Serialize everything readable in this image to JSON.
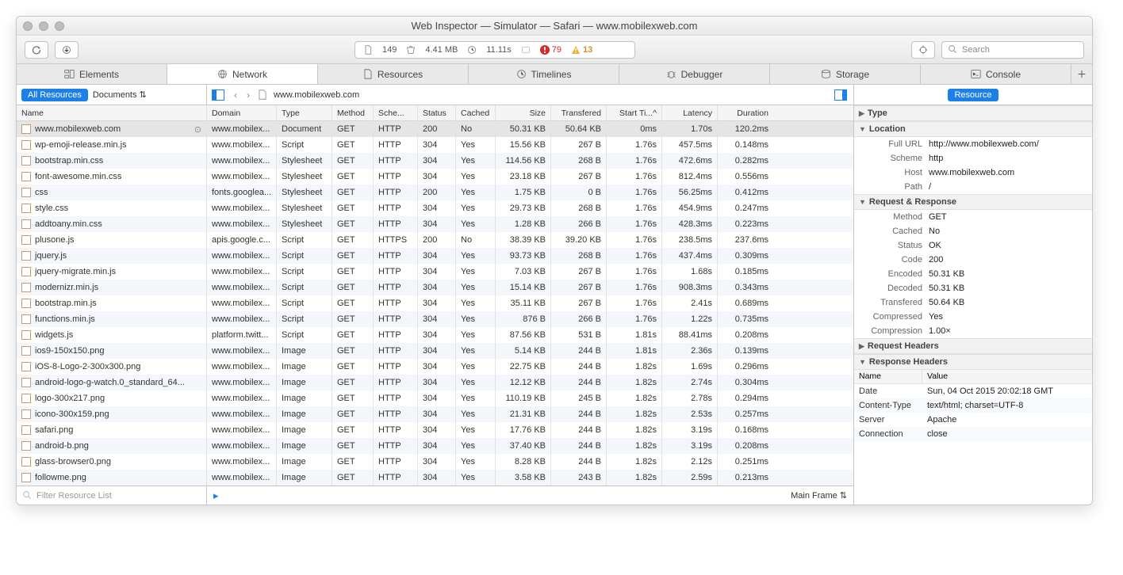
{
  "window_title": "Web Inspector — Simulator — Safari — www.mobilexweb.com",
  "toolbar": {
    "counts_file": "149",
    "weight": "4.41 MB",
    "time": "11.11s",
    "errors": "79",
    "warnings": "13",
    "search_placeholder": "Search"
  },
  "tabs": [
    "Elements",
    "Network",
    "Resources",
    "Timelines",
    "Debugger",
    "Storage",
    "Console"
  ],
  "filterbar": {
    "pill": "All Resources",
    "doc": "Documents",
    "crumb": "www.mobilexweb.com"
  },
  "side_pill": "Resource",
  "columns": [
    "Name",
    "Domain",
    "Type",
    "Method",
    "Sche...",
    "Status",
    "Cached",
    "Size",
    "Transfered",
    "Start Ti...",
    "Latency",
    "Duration"
  ],
  "rows": [
    {
      "name": "www.mobilexweb.com",
      "dom": "www.mobilex...",
      "type": "Document",
      "meth": "GET",
      "sch": "HTTP",
      "stat": "200",
      "cac": "No",
      "size": "50.31 KB",
      "tran": "50.64 KB",
      "start": "0ms",
      "lat": "1.70s",
      "dur": "120.2ms",
      "sel": true
    },
    {
      "name": "wp-emoji-release.min.js",
      "dom": "www.mobilex...",
      "type": "Script",
      "meth": "GET",
      "sch": "HTTP",
      "stat": "304",
      "cac": "Yes",
      "size": "15.56 KB",
      "tran": "267 B",
      "start": "1.76s",
      "lat": "457.5ms",
      "dur": "0.148ms"
    },
    {
      "name": "bootstrap.min.css",
      "dom": "www.mobilex...",
      "type": "Stylesheet",
      "meth": "GET",
      "sch": "HTTP",
      "stat": "304",
      "cac": "Yes",
      "size": "114.56 KB",
      "tran": "268 B",
      "start": "1.76s",
      "lat": "472.6ms",
      "dur": "0.282ms"
    },
    {
      "name": "font-awesome.min.css",
      "dom": "www.mobilex...",
      "type": "Stylesheet",
      "meth": "GET",
      "sch": "HTTP",
      "stat": "304",
      "cac": "Yes",
      "size": "23.18 KB",
      "tran": "267 B",
      "start": "1.76s",
      "lat": "812.4ms",
      "dur": "0.556ms"
    },
    {
      "name": "css",
      "dom": "fonts.googlea...",
      "type": "Stylesheet",
      "meth": "GET",
      "sch": "HTTP",
      "stat": "200",
      "cac": "Yes",
      "size": "1.75 KB",
      "tran": "0 B",
      "start": "1.76s",
      "lat": "56.25ms",
      "dur": "0.412ms"
    },
    {
      "name": "style.css",
      "dom": "www.mobilex...",
      "type": "Stylesheet",
      "meth": "GET",
      "sch": "HTTP",
      "stat": "304",
      "cac": "Yes",
      "size": "29.73 KB",
      "tran": "268 B",
      "start": "1.76s",
      "lat": "454.9ms",
      "dur": "0.247ms"
    },
    {
      "name": "addtoany.min.css",
      "dom": "www.mobilex...",
      "type": "Stylesheet",
      "meth": "GET",
      "sch": "HTTP",
      "stat": "304",
      "cac": "Yes",
      "size": "1.28 KB",
      "tran": "266 B",
      "start": "1.76s",
      "lat": "428.3ms",
      "dur": "0.223ms"
    },
    {
      "name": "plusone.js",
      "dom": "apis.google.c...",
      "type": "Script",
      "meth": "GET",
      "sch": "HTTPS",
      "stat": "200",
      "cac": "No",
      "size": "38.39 KB",
      "tran": "39.20 KB",
      "start": "1.76s",
      "lat": "238.5ms",
      "dur": "237.6ms"
    },
    {
      "name": "jquery.js",
      "dom": "www.mobilex...",
      "type": "Script",
      "meth": "GET",
      "sch": "HTTP",
      "stat": "304",
      "cac": "Yes",
      "size": "93.73 KB",
      "tran": "268 B",
      "start": "1.76s",
      "lat": "437.4ms",
      "dur": "0.309ms"
    },
    {
      "name": "jquery-migrate.min.js",
      "dom": "www.mobilex...",
      "type": "Script",
      "meth": "GET",
      "sch": "HTTP",
      "stat": "304",
      "cac": "Yes",
      "size": "7.03 KB",
      "tran": "267 B",
      "start": "1.76s",
      "lat": "1.68s",
      "dur": "0.185ms"
    },
    {
      "name": "modernizr.min.js",
      "dom": "www.mobilex...",
      "type": "Script",
      "meth": "GET",
      "sch": "HTTP",
      "stat": "304",
      "cac": "Yes",
      "size": "15.14 KB",
      "tran": "267 B",
      "start": "1.76s",
      "lat": "908.3ms",
      "dur": "0.343ms"
    },
    {
      "name": "bootstrap.min.js",
      "dom": "www.mobilex...",
      "type": "Script",
      "meth": "GET",
      "sch": "HTTP",
      "stat": "304",
      "cac": "Yes",
      "size": "35.11 KB",
      "tran": "267 B",
      "start": "1.76s",
      "lat": "2.41s",
      "dur": "0.689ms"
    },
    {
      "name": "functions.min.js",
      "dom": "www.mobilex...",
      "type": "Script",
      "meth": "GET",
      "sch": "HTTP",
      "stat": "304",
      "cac": "Yes",
      "size": "876 B",
      "tran": "266 B",
      "start": "1.76s",
      "lat": "1.22s",
      "dur": "0.735ms"
    },
    {
      "name": "widgets.js",
      "dom": "platform.twitt...",
      "type": "Script",
      "meth": "GET",
      "sch": "HTTP",
      "stat": "304",
      "cac": "Yes",
      "size": "87.56 KB",
      "tran": "531 B",
      "start": "1.81s",
      "lat": "88.41ms",
      "dur": "0.208ms"
    },
    {
      "name": "ios9-150x150.png",
      "dom": "www.mobilex...",
      "type": "Image",
      "meth": "GET",
      "sch": "HTTP",
      "stat": "304",
      "cac": "Yes",
      "size": "5.14 KB",
      "tran": "244 B",
      "start": "1.81s",
      "lat": "2.36s",
      "dur": "0.139ms"
    },
    {
      "name": "iOS-8-Logo-2-300x300.png",
      "dom": "www.mobilex...",
      "type": "Image",
      "meth": "GET",
      "sch": "HTTP",
      "stat": "304",
      "cac": "Yes",
      "size": "22.75 KB",
      "tran": "244 B",
      "start": "1.82s",
      "lat": "1.69s",
      "dur": "0.296ms"
    },
    {
      "name": "android-logo-g-watch.0_standard_64...",
      "dom": "www.mobilex...",
      "type": "Image",
      "meth": "GET",
      "sch": "HTTP",
      "stat": "304",
      "cac": "Yes",
      "size": "12.12 KB",
      "tran": "244 B",
      "start": "1.82s",
      "lat": "2.74s",
      "dur": "0.304ms"
    },
    {
      "name": "logo-300x217.png",
      "dom": "www.mobilex...",
      "type": "Image",
      "meth": "GET",
      "sch": "HTTP",
      "stat": "304",
      "cac": "Yes",
      "size": "110.19 KB",
      "tran": "245 B",
      "start": "1.82s",
      "lat": "2.78s",
      "dur": "0.294ms"
    },
    {
      "name": "icono-300x159.png",
      "dom": "www.mobilex...",
      "type": "Image",
      "meth": "GET",
      "sch": "HTTP",
      "stat": "304",
      "cac": "Yes",
      "size": "21.31 KB",
      "tran": "244 B",
      "start": "1.82s",
      "lat": "2.53s",
      "dur": "0.257ms"
    },
    {
      "name": "safari.png",
      "dom": "www.mobilex...",
      "type": "Image",
      "meth": "GET",
      "sch": "HTTP",
      "stat": "304",
      "cac": "Yes",
      "size": "17.76 KB",
      "tran": "244 B",
      "start": "1.82s",
      "lat": "3.19s",
      "dur": "0.168ms"
    },
    {
      "name": "android-b.png",
      "dom": "www.mobilex...",
      "type": "Image",
      "meth": "GET",
      "sch": "HTTP",
      "stat": "304",
      "cac": "Yes",
      "size": "37.40 KB",
      "tran": "244 B",
      "start": "1.82s",
      "lat": "3.19s",
      "dur": "0.208ms"
    },
    {
      "name": "glass-browser0.png",
      "dom": "www.mobilex...",
      "type": "Image",
      "meth": "GET",
      "sch": "HTTP",
      "stat": "304",
      "cac": "Yes",
      "size": "8.28 KB",
      "tran": "244 B",
      "start": "1.82s",
      "lat": "2.12s",
      "dur": "0.251ms"
    },
    {
      "name": "followme.png",
      "dom": "www.mobilex...",
      "type": "Image",
      "meth": "GET",
      "sch": "HTTP",
      "stat": "304",
      "cac": "Yes",
      "size": "3.58 KB",
      "tran": "243 B",
      "start": "1.82s",
      "lat": "2.59s",
      "dur": "0.213ms"
    }
  ],
  "footer": {
    "filter_ph": "Filter Resource List",
    "mainframe": "Main Frame"
  },
  "details": {
    "type_h": "Type",
    "loc_h": "Location",
    "loc": {
      "Full URL": "http://www.mobilexweb.com/",
      "Scheme": "http",
      "Host": "www.mobilexweb.com",
      "Path": "/"
    },
    "rr_h": "Request & Response",
    "rr": {
      "Method": "GET",
      "Cached": "No",
      "Status": "OK",
      "Code": "200",
      "Encoded": "50.31 KB",
      "Decoded": "50.31 KB",
      "Transfered": "50.64 KB",
      "Compressed": "Yes",
      "Compression": "1.00×"
    },
    "reqh_h": "Request Headers",
    "resh_h": "Response Headers",
    "resh_cols": [
      "Name",
      "Value"
    ],
    "resh": [
      {
        "n": "Date",
        "v": "Sun, 04 Oct 2015 20:02:18 GMT"
      },
      {
        "n": "Content-Type",
        "v": "text/html; charset=UTF-8"
      },
      {
        "n": "Server",
        "v": "Apache"
      },
      {
        "n": "Connection",
        "v": "close"
      }
    ]
  }
}
